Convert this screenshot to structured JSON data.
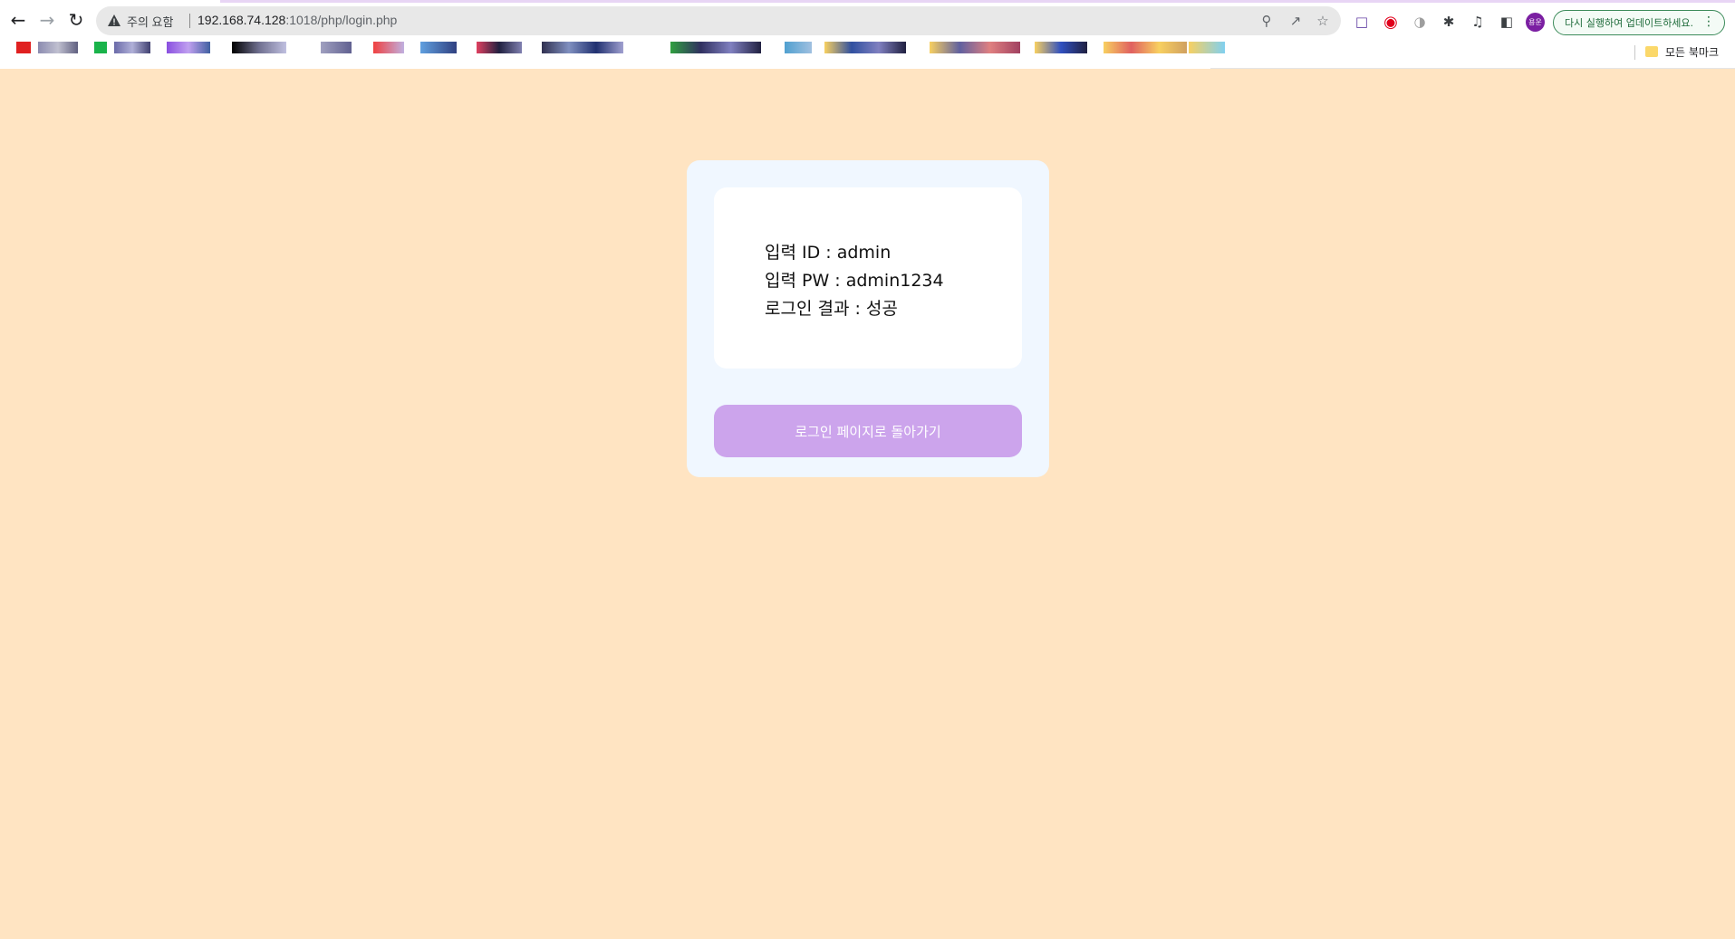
{
  "browser": {
    "security_warning": "주의 요함",
    "url_host": "192.168.74.128",
    "url_rest": ":1018/php/login.php",
    "profile_initials": "용운",
    "update_button_label": "다시 실행하여 업데이트하세요.",
    "all_bookmarks_label": "모든 북마크"
  },
  "result": {
    "id_line": "입력 ID : admin",
    "pw_line": "입력 PW : admin1234",
    "result_line": "로그인 결과 : 성공"
  },
  "actions": {
    "back_button_label": "로그인 페이지로 돌아가기"
  },
  "colors": {
    "page_background": "#ffe4c2",
    "card_background": "#f0f7ff",
    "result_box_background": "#ffffff",
    "button_background": "#cca4ec"
  }
}
